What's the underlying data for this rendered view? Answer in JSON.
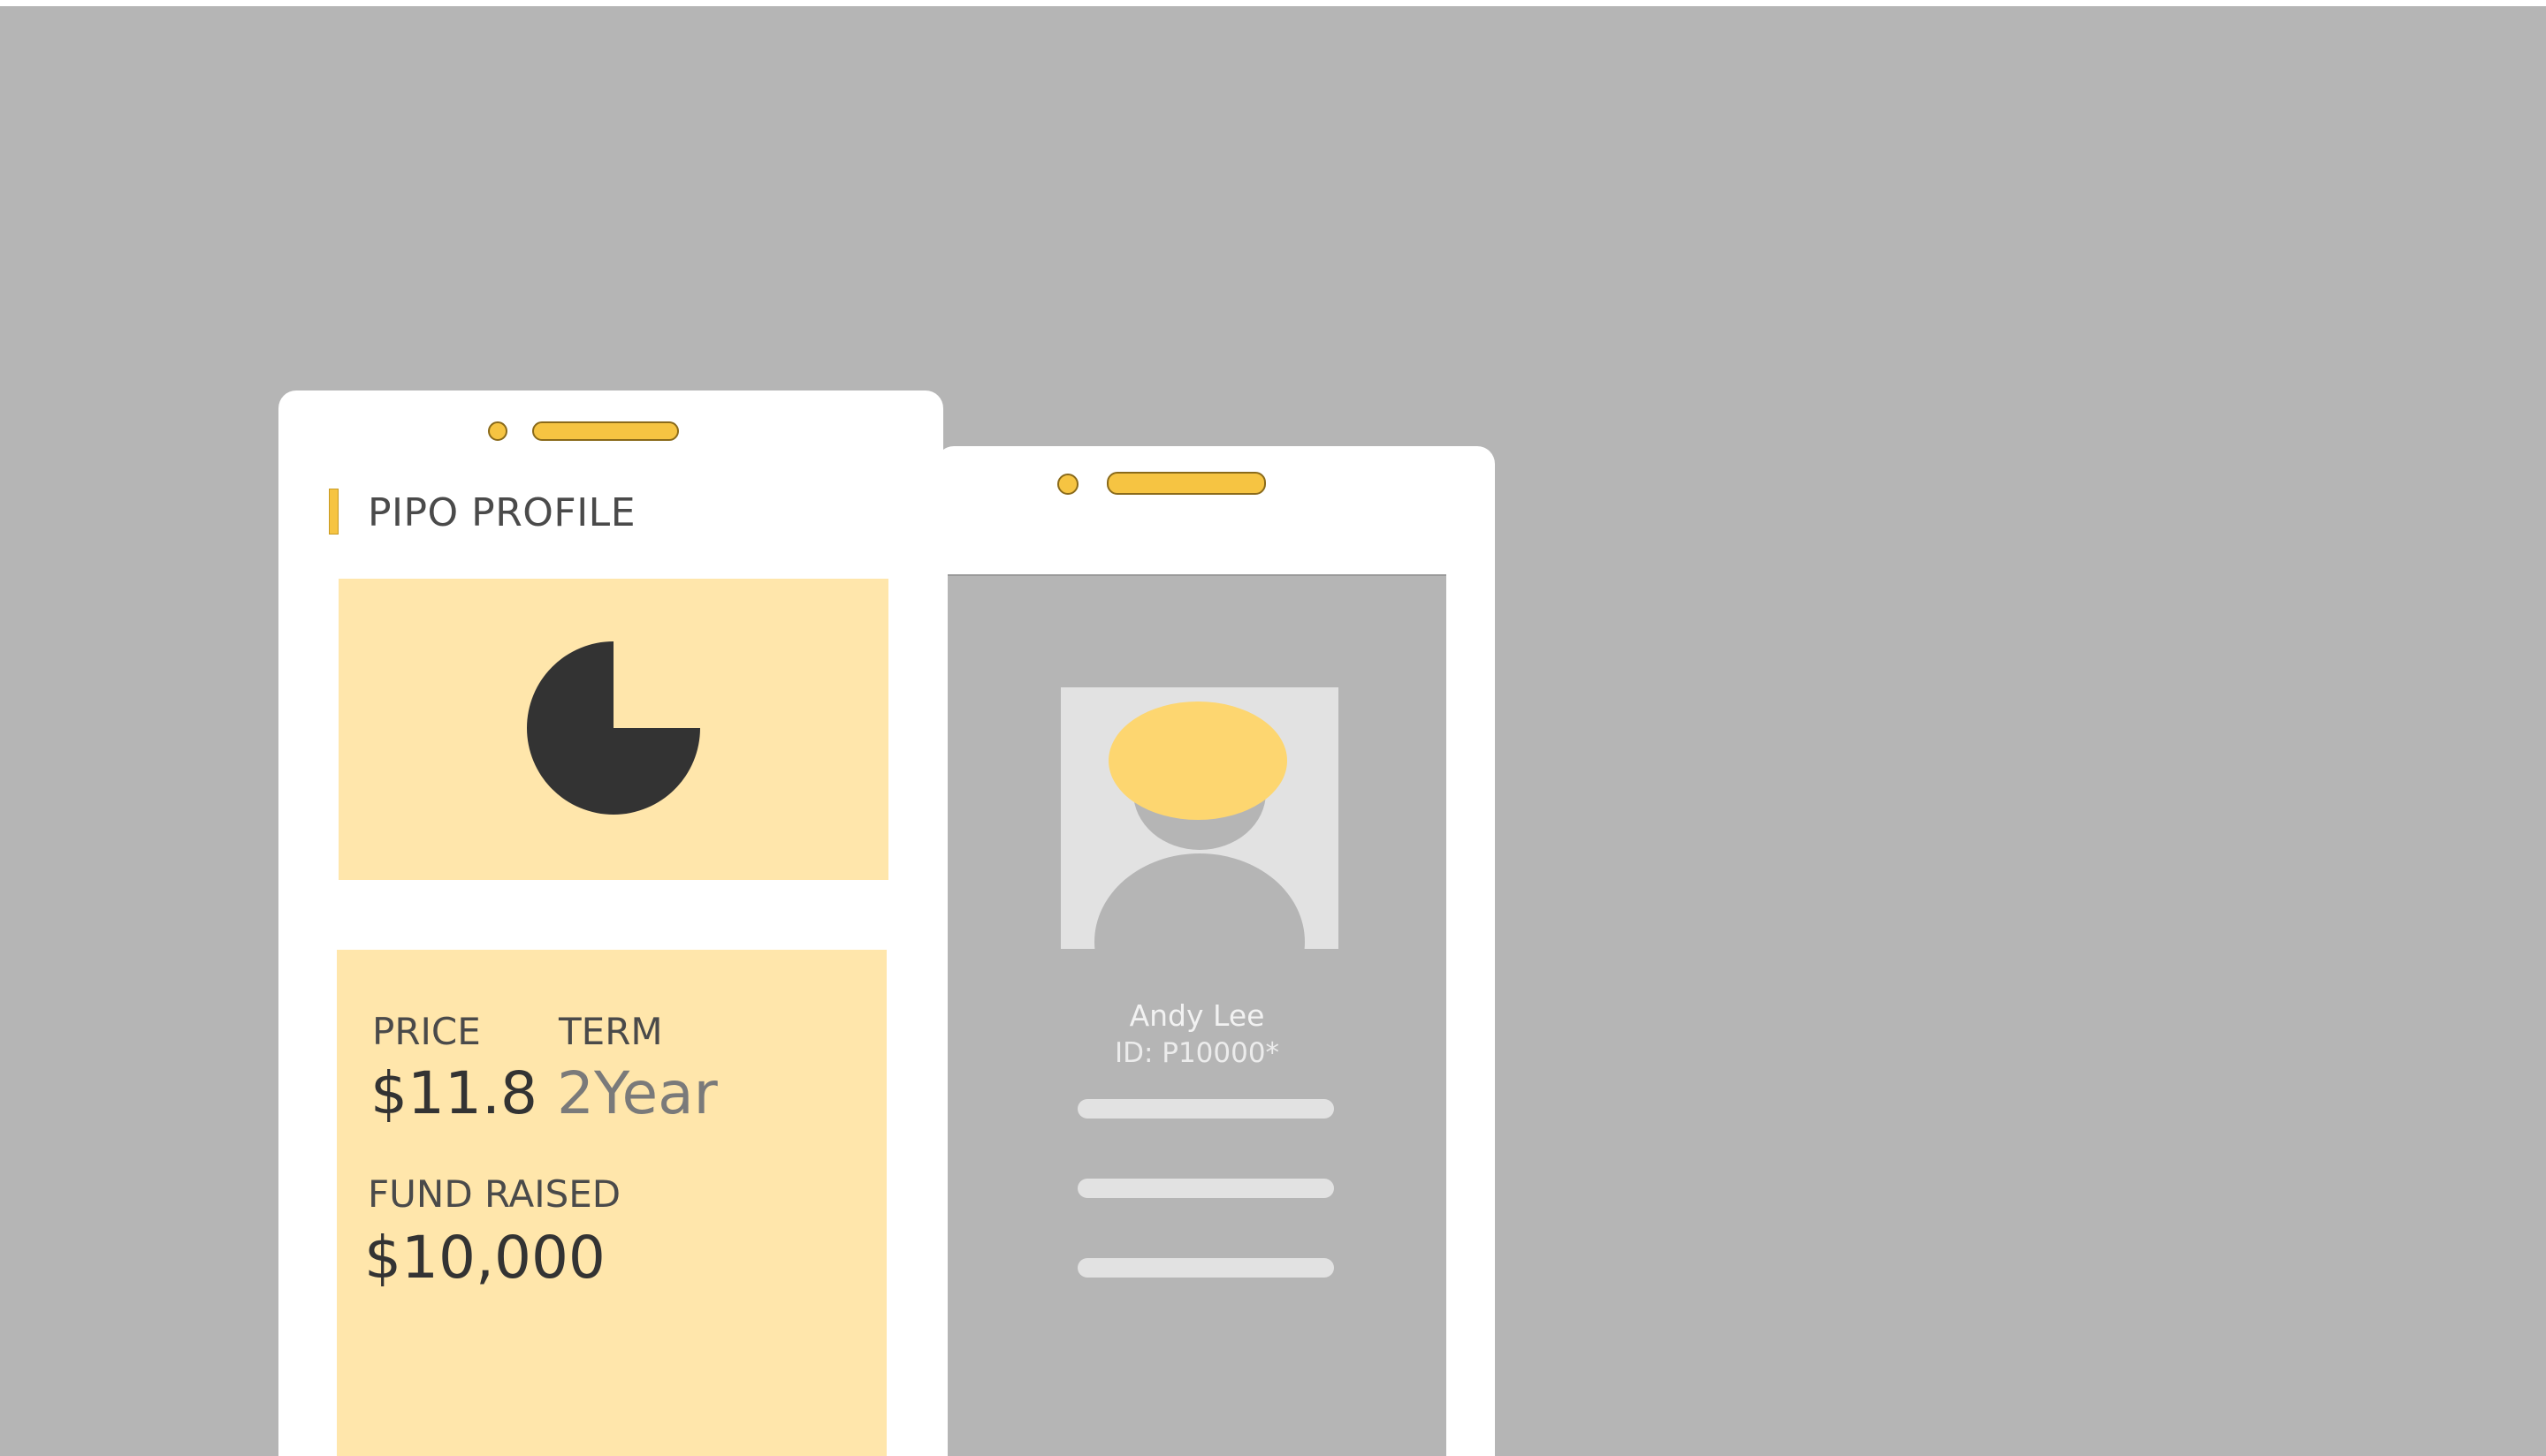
{
  "profile_phone": {
    "title": "PIPO PROFILE",
    "pie": {
      "highlight_fraction": 0.25
    },
    "price_label": "PRICE",
    "price_value": "$11.8",
    "term_label": "TERM",
    "term_value": "2Year",
    "fund_label": "FUND RAISED",
    "fund_value": "$10,000"
  },
  "user_phone": {
    "name": "Andy Lee",
    "id_text": "ID: P10000*"
  },
  "colors": {
    "background": "#b5b5b5",
    "accent_yellow": "#f6c442",
    "card_yellow": "#ffe6ab",
    "dark": "#333333",
    "skeleton": "#e2e2e2",
    "avatar_hair": "#fdd670"
  }
}
